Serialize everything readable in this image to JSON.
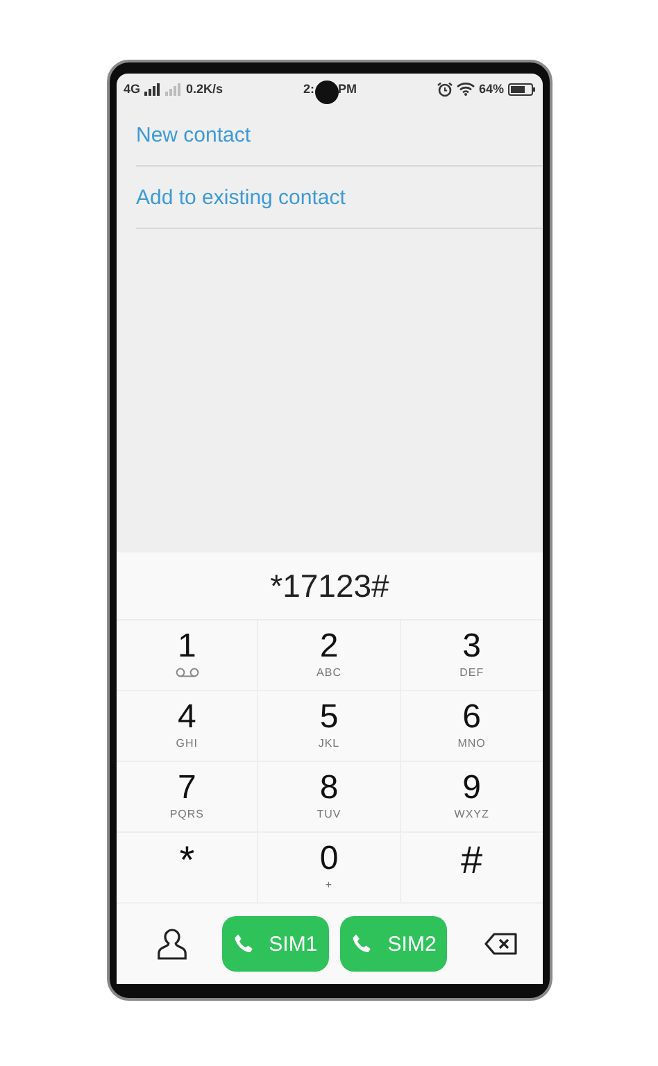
{
  "status_bar": {
    "network": "4G",
    "speed": "0.2K/s",
    "time_start": "2:",
    "time_end": "PM",
    "battery": "64%"
  },
  "actions": [
    {
      "label": "New contact"
    },
    {
      "label": "Add to existing contact"
    }
  ],
  "dialed_number": "*17123#",
  "keys": [
    {
      "kind": "voicemail",
      "digit": "1"
    },
    {
      "kind": "letters",
      "digit": "2",
      "sub": "ABC"
    },
    {
      "kind": "letters",
      "digit": "3",
      "sub": "DEF"
    },
    {
      "kind": "letters",
      "digit": "4",
      "sub": "GHI"
    },
    {
      "kind": "letters",
      "digit": "5",
      "sub": "JKL"
    },
    {
      "kind": "letters",
      "digit": "6",
      "sub": "MNO"
    },
    {
      "kind": "letters",
      "digit": "7",
      "sub": "PQRS"
    },
    {
      "kind": "letters",
      "digit": "8",
      "sub": "TUV"
    },
    {
      "kind": "letters",
      "digit": "9",
      "sub": "WXYZ"
    },
    {
      "kind": "symbol",
      "digit": "*"
    },
    {
      "kind": "letters",
      "digit": "0",
      "sub": "+"
    },
    {
      "kind": "symbol",
      "digit": "#"
    }
  ],
  "call_buttons": [
    {
      "label": "SIM1"
    },
    {
      "label": "SIM2"
    }
  ]
}
